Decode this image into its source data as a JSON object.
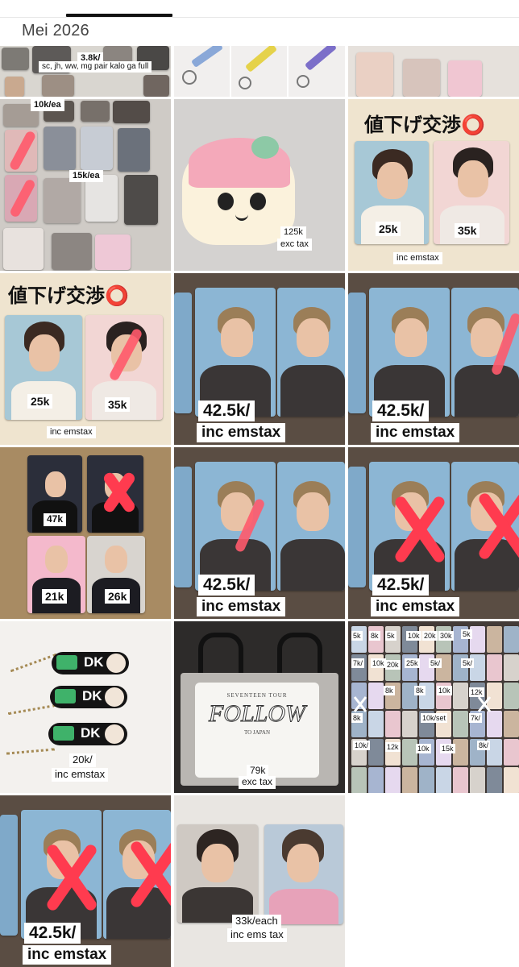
{
  "header": {
    "month": "Mei 2026"
  },
  "tiles": [
    {
      "id": "r0c0",
      "labels": [
        "3.8k/",
        "sc, jh, ww, mg pair kalo ga full"
      ]
    },
    {
      "id": "r0c1",
      "labels": []
    },
    {
      "id": "r0c2",
      "labels": []
    },
    {
      "id": "r1c0",
      "labels": [
        "10k/ea",
        "15k/ea"
      ]
    },
    {
      "id": "r1c1",
      "labels": [
        "125k",
        "exc tax"
      ]
    },
    {
      "id": "r1c2",
      "labels": [
        "値下げ交渉⭕",
        "25k",
        "35k",
        "inc emstax"
      ]
    },
    {
      "id": "r2c0",
      "labels": [
        "値下げ交渉⭕",
        "25k",
        "35k",
        "inc emstax"
      ]
    },
    {
      "id": "r2c1",
      "labels": [
        "42.5k/",
        "inc emstax"
      ]
    },
    {
      "id": "r2c2",
      "labels": [
        "42.5k/",
        "inc emstax"
      ]
    },
    {
      "id": "r3c0",
      "labels": [
        "47k",
        "21k",
        "26k"
      ]
    },
    {
      "id": "r3c1",
      "labels": [
        "42.5k/",
        "inc emstax"
      ]
    },
    {
      "id": "r3c2",
      "labels": [
        "42.5k/",
        "inc emstax"
      ]
    },
    {
      "id": "r4c0",
      "labels": [
        "20k/",
        "inc emstax",
        "DK",
        "DK",
        "DK"
      ]
    },
    {
      "id": "r4c1",
      "labels": [
        "79k",
        "exc tax",
        "SEVENTEEN TOUR",
        "FOLLOW",
        "TO JAPAN"
      ]
    },
    {
      "id": "r4c2",
      "labels": [
        "5k",
        "8k",
        "5k",
        "10k",
        "20k",
        "30k",
        "5k",
        "7k/",
        "10k",
        "20k",
        "25k",
        "5k/",
        "5k/",
        "8k",
        "8k",
        "10k",
        "12k",
        "8k",
        "10k/set",
        "7k/",
        "10k/",
        "12k",
        "10k",
        "15k",
        "8k/"
      ]
    },
    {
      "id": "r5c0",
      "labels": [
        "42.5k/",
        "inc emstax"
      ]
    },
    {
      "id": "r5c1",
      "labels": [
        "33k/each",
        "inc ems tax"
      ]
    }
  ],
  "colors": {
    "cross": "#ff3b4f",
    "label_bg": "#ffffff",
    "header_text": "#444444"
  }
}
